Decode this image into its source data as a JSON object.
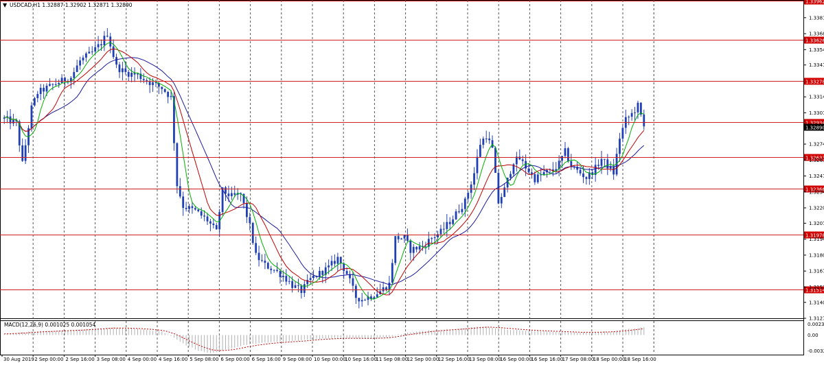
{
  "header": {
    "symbol_line": "USDCAD,H1  1.32887 1.32902 1.32871 1.32890",
    "indicator_line": "MACD(12,26,9) 0.001025 0.001054"
  },
  "colors": {
    "background": "#ffffff",
    "candles": "#1f3fb5",
    "sma_fast": "#00b000",
    "sma_mid": "#c00000",
    "sma_slow": "#1a1aa0",
    "hline": "#cc2020",
    "hline_label_bg": "#d00000",
    "grid": "#444444",
    "macd_hist": "#b0b0b0",
    "macd_signal": "#c00000"
  },
  "chart_data": [
    {
      "type": "candlestick",
      "title": "USDCAD,H1",
      "ohlc_readout": [
        1.32887,
        1.32902,
        1.32871,
        1.3289
      ],
      "ylim": [
        1.3127,
        1.33965
      ],
      "y_ticks": [
        "1.33815",
        "1.33680",
        "1.33545",
        "1.33415",
        "1.33145",
        "1.33010",
        "1.32745",
        "1.32610",
        "1.32475",
        "1.32340",
        "1.32205",
        "1.32075",
        "1.31940",
        "1.31805",
        "1.31670",
        "1.31535",
        "1.31405",
        "1.31270"
      ],
      "x_labels": [
        "30 Aug 2019",
        "2 Sep 00:00",
        "2 Sep 16:00",
        "3 Sep 08:00",
        "4 Sep 00:00",
        "4 Sep 16:00",
        "5 Sep 08:00",
        "6 Sep 00:00",
        "6 Sep 16:00",
        "9 Sep 08:00",
        "10 Sep 00:00",
        "10 Sep 16:00",
        "11 Sep 08:00",
        "12 Sep 00:00",
        "12 Sep 16:00",
        "13 Sep 08:00",
        "16 Sep 00:00",
        "16 Sep 16:00",
        "17 Sep 08:00",
        "18 Sep 00:00",
        "18 Sep 16:00"
      ],
      "price_path_anchors": [
        [
          0,
          1.3296
        ],
        [
          4,
          1.3292
        ],
        [
          6,
          1.3258
        ],
        [
          9,
          1.3305
        ],
        [
          11,
          1.3318
        ],
        [
          14,
          1.3322
        ],
        [
          18,
          1.3327
        ],
        [
          22,
          1.3331
        ],
        [
          25,
          1.3345
        ],
        [
          29,
          1.3352
        ],
        [
          32,
          1.336
        ],
        [
          34,
          1.3368
        ],
        [
          37,
          1.334
        ],
        [
          40,
          1.3335
        ],
        [
          44,
          1.3333
        ],
        [
          47,
          1.3328
        ],
        [
          52,
          1.3322
        ],
        [
          55,
          1.3314
        ],
        [
          57,
          1.324
        ],
        [
          59,
          1.3222
        ],
        [
          63,
          1.3218
        ],
        [
          67,
          1.321
        ],
        [
          70,
          1.32
        ],
        [
          72,
          1.3235
        ],
        [
          75,
          1.323
        ],
        [
          78,
          1.3232
        ],
        [
          81,
          1.3205
        ],
        [
          83,
          1.318
        ],
        [
          86,
          1.3172
        ],
        [
          89,
          1.3168
        ],
        [
          92,
          1.3163
        ],
        [
          95,
          1.3155
        ],
        [
          98,
          1.315
        ],
        [
          101,
          1.316
        ],
        [
          104,
          1.3165
        ],
        [
          107,
          1.317
        ],
        [
          110,
          1.3178
        ],
        [
          113,
          1.3165
        ],
        [
          116,
          1.3145
        ],
        [
          118,
          1.3143
        ],
        [
          121,
          1.3146
        ],
        [
          124,
          1.315
        ],
        [
          127,
          1.3156
        ],
        [
          129,
          1.3195
        ],
        [
          132,
          1.3195
        ],
        [
          134,
          1.3185
        ],
        [
          138,
          1.3188
        ],
        [
          141,
          1.3195
        ],
        [
          144,
          1.32
        ],
        [
          148,
          1.3212
        ],
        [
          152,
          1.3226
        ],
        [
          155,
          1.325
        ],
        [
          157,
          1.3275
        ],
        [
          159,
          1.3282
        ],
        [
          161,
          1.327
        ],
        [
          163,
          1.3225
        ],
        [
          165,
          1.3236
        ],
        [
          168,
          1.326
        ],
        [
          170,
          1.3262
        ],
        [
          172,
          1.3255
        ],
        [
          175,
          1.3245
        ],
        [
          178,
          1.325
        ],
        [
          181,
          1.3252
        ],
        [
          183,
          1.3258
        ],
        [
          185,
          1.3268
        ],
        [
          187,
          1.3256
        ],
        [
          189,
          1.3252
        ],
        [
          192,
          1.3246
        ],
        [
          195,
          1.3254
        ],
        [
          197,
          1.3262
        ],
        [
          199,
          1.3256
        ],
        [
          201,
          1.325
        ],
        [
          203,
          1.328
        ],
        [
          205,
          1.3295
        ],
        [
          207,
          1.33
        ],
        [
          209,
          1.3307
        ],
        [
          211,
          1.3289
        ]
      ],
      "moving_averages": [
        "fast",
        "mid",
        "slow"
      ]
    },
    {
      "type": "histogram",
      "title": "MACD(12,26,9)",
      "values_readout": [
        0.001025,
        0.001054
      ],
      "ylim": [
        -0.00322,
        0.00238
      ],
      "y_ticks": [
        "0.00238",
        "0.00",
        "-0.00322"
      ],
      "histogram_path_anchors": [
        [
          0,
          0.0002
        ],
        [
          10,
          0.0006
        ],
        [
          25,
          0.0009
        ],
        [
          35,
          0.0013
        ],
        [
          45,
          0.001
        ],
        [
          52,
          0.0006
        ],
        [
          56,
          -0.0005
        ],
        [
          60,
          -0.0018
        ],
        [
          64,
          -0.0026
        ],
        [
          68,
          -0.0031
        ],
        [
          74,
          -0.0024
        ],
        [
          80,
          -0.0016
        ],
        [
          88,
          -0.0012
        ],
        [
          96,
          -0.001
        ],
        [
          104,
          -0.0006
        ],
        [
          112,
          -0.0005
        ],
        [
          120,
          -0.0006
        ],
        [
          126,
          -0.0004
        ],
        [
          132,
          0.0003
        ],
        [
          140,
          0.0008
        ],
        [
          150,
          0.0011
        ],
        [
          158,
          0.0015
        ],
        [
          162,
          0.0012
        ],
        [
          170,
          0.0008
        ],
        [
          180,
          0.0006
        ],
        [
          190,
          0.0004
        ],
        [
          200,
          0.0006
        ],
        [
          206,
          0.001
        ],
        [
          211,
          0.0013
        ]
      ]
    }
  ],
  "horizontal_levels": [
    {
      "value": 1.33962,
      "label": "1.33962"
    },
    {
      "value": 1.33626,
      "label": "1.33626"
    },
    {
      "value": 1.33278,
      "label": "1.33278"
    },
    {
      "value": 1.32934,
      "label": "1.32934"
    },
    {
      "value": 1.32633,
      "label": "1.32633"
    },
    {
      "value": 1.32366,
      "label": "1.32366"
    },
    {
      "value": 1.31978,
      "label": "1.31978"
    },
    {
      "value": 1.31514,
      "label": "1.31514"
    }
  ],
  "current_price": {
    "value": 1.3289,
    "label": "1.32890"
  }
}
